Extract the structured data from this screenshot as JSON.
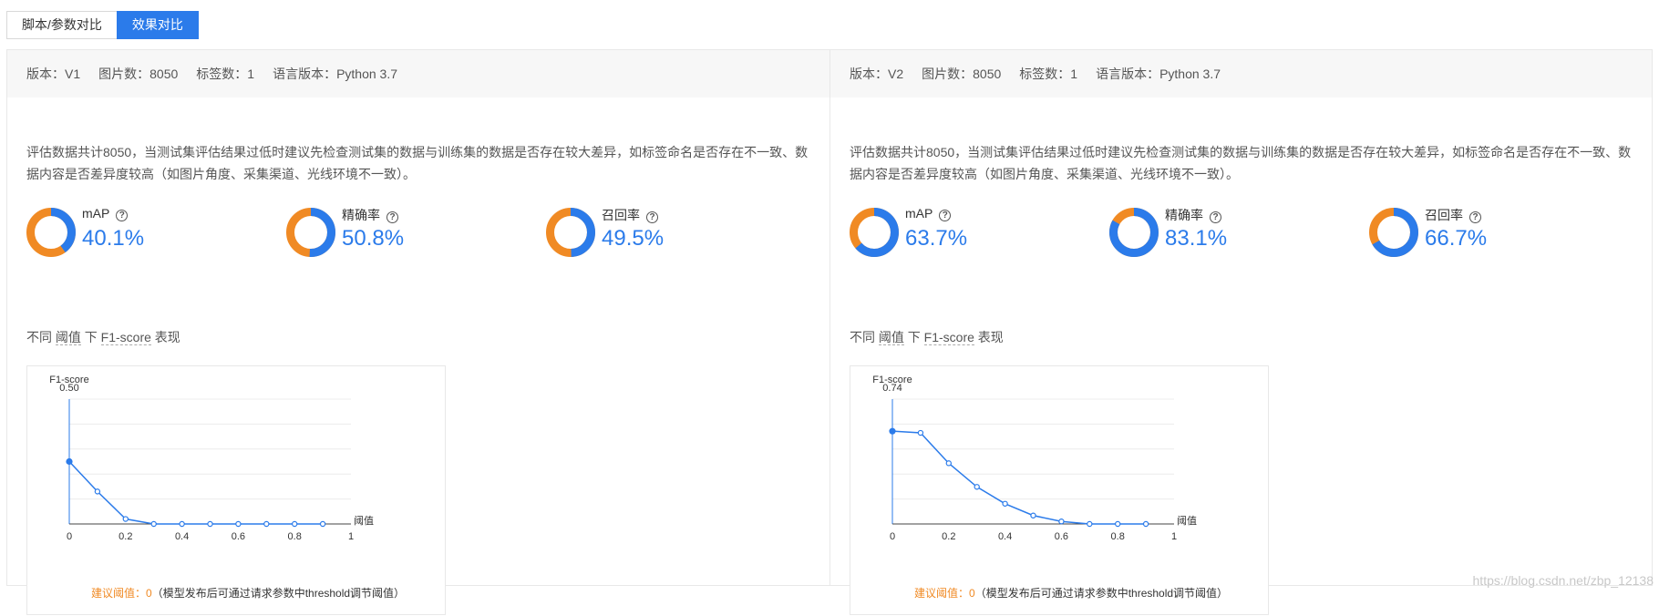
{
  "tabs": [
    {
      "label": "脚本/参数对比",
      "active": false
    },
    {
      "label": "效果对比",
      "active": true
    }
  ],
  "panels": [
    {
      "info": {
        "version": "版本：V1",
        "images": "图片数：8050",
        "labels": "标签数：1",
        "language": "语言版本：Python 3.7"
      },
      "description": "评估数据共计8050，当测试集评估结果过低时建议先检查测试集的数据与训练集的数据是否存在较大差异，如标签命名是否存在不一致、数据内容是否差异度较高（如图片角度、采集渠道、光线环境不一致）。",
      "metrics": [
        {
          "name": "mAP",
          "value": "40.1%",
          "fraction": 0.401
        },
        {
          "name": "精确率",
          "value": "50.8%",
          "fraction": 0.508
        },
        {
          "name": "召回率",
          "value": "49.5%",
          "fraction": 0.495
        }
      ],
      "subtitle": {
        "p1": "不同 ",
        "p2": "阈值",
        "p3": " 下 ",
        "p4": "F1-score",
        "p5": " 表现"
      },
      "tip": {
        "label": "建议阈值：0",
        "note": "（模型发布后可通过请求参数中threshold调节阈值）"
      },
      "chart_data": {
        "type": "line",
        "ylabel": "F1-score",
        "xlabel": "阈值",
        "xlim": [
          0,
          1
        ],
        "ylim": [
          0,
          0.5
        ],
        "ytick_top": "0.50",
        "xticks": [
          "0",
          "0.2",
          "0.4",
          "0.6",
          "0.8",
          "1"
        ],
        "x": [
          0,
          0.1,
          0.2,
          0.3,
          0.4,
          0.5,
          0.6,
          0.7,
          0.8,
          0.9
        ],
        "y": [
          0.25,
          0.13,
          0.02,
          0.0,
          0.0,
          0.0,
          0.0,
          0.0,
          0.0,
          0.0
        ],
        "grid": true,
        "color": "#2b7bea"
      }
    },
    {
      "info": {
        "version": "版本：V2",
        "images": "图片数：8050",
        "labels": "标签数：1",
        "language": "语言版本：Python 3.7"
      },
      "description": "评估数据共计8050，当测试集评估结果过低时建议先检查测试集的数据与训练集的数据是否存在较大差异，如标签命名是否存在不一致、数据内容是否差异度较高（如图片角度、采集渠道、光线环境不一致）。",
      "metrics": [
        {
          "name": "mAP",
          "value": "63.7%",
          "fraction": 0.637
        },
        {
          "name": "精确率",
          "value": "83.1%",
          "fraction": 0.831
        },
        {
          "name": "召回率",
          "value": "66.7%",
          "fraction": 0.667
        }
      ],
      "subtitle": {
        "p1": "不同 ",
        "p2": "阈值",
        "p3": " 下 ",
        "p4": "F1-score",
        "p5": " 表现"
      },
      "tip": {
        "label": "建议阈值：0",
        "note": "（模型发布后可通过请求参数中threshold调节阈值）"
      },
      "chart_data": {
        "type": "line",
        "ylabel": "F1-score",
        "xlabel": "阈值",
        "xlim": [
          0,
          1
        ],
        "ylim": [
          0,
          0.74
        ],
        "ytick_top": "0.74",
        "xticks": [
          "0",
          "0.2",
          "0.4",
          "0.6",
          "0.8",
          "1"
        ],
        "x": [
          0,
          0.1,
          0.2,
          0.3,
          0.4,
          0.5,
          0.6,
          0.7,
          0.8,
          0.9
        ],
        "y": [
          0.55,
          0.54,
          0.36,
          0.22,
          0.12,
          0.05,
          0.015,
          0.0,
          0.0,
          0.0
        ],
        "grid": true,
        "color": "#2b7bea"
      }
    }
  ],
  "colors": {
    "accent": "#2b7bea",
    "ring_rest": "#f08a24"
  },
  "watermark": "https://blog.csdn.net/zbp_12138"
}
